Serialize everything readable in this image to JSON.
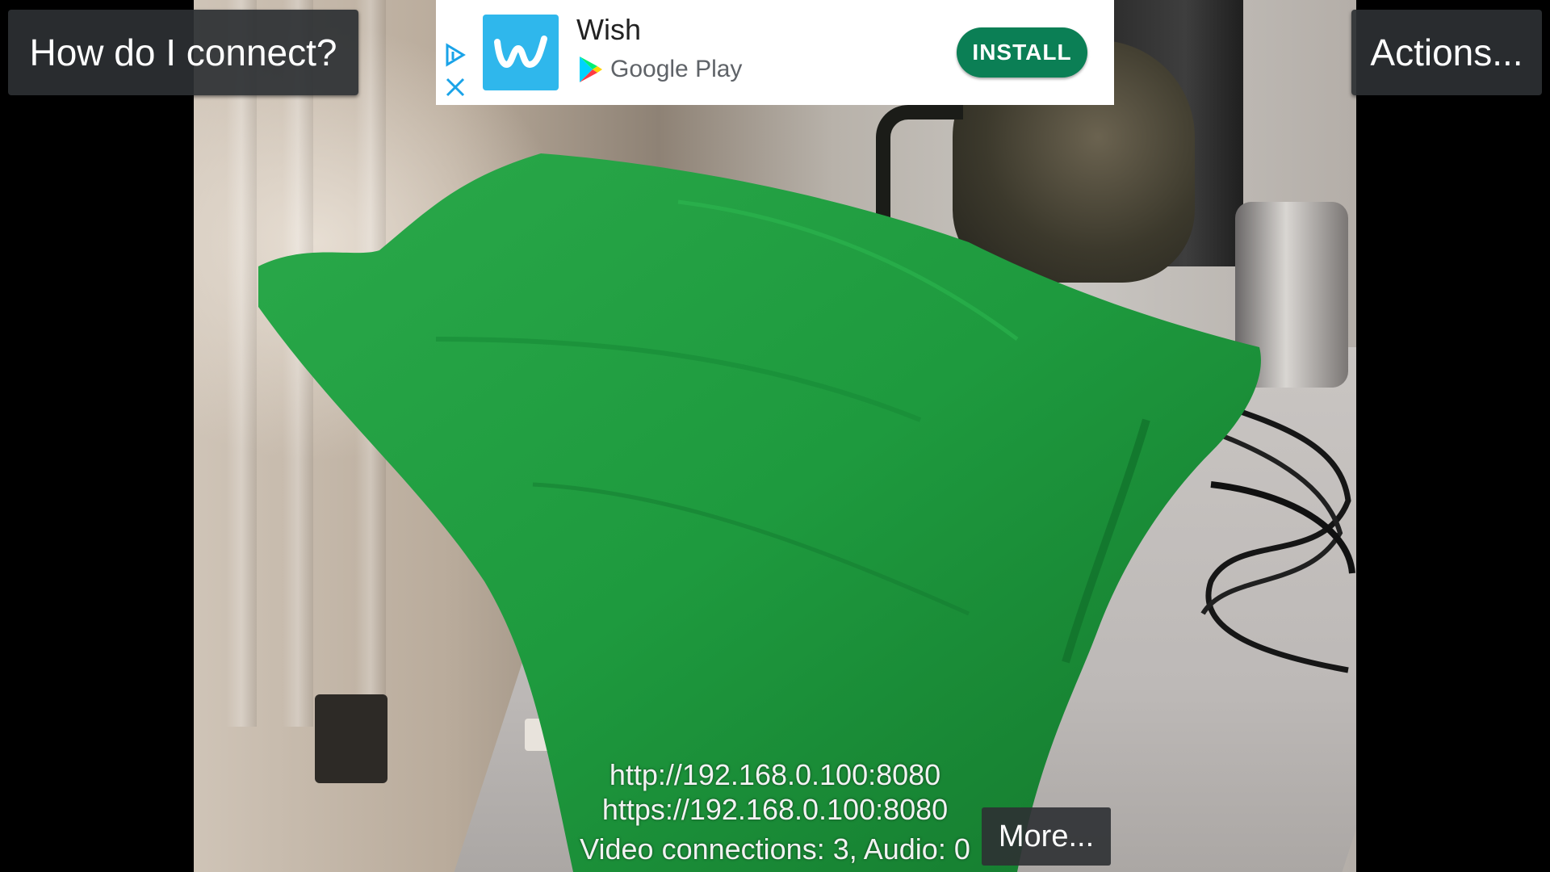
{
  "top_bar": {
    "help_label": "How do I connect?",
    "actions_label": "Actions..."
  },
  "ad": {
    "app_name": "Wish",
    "store_name": "Google Play",
    "install_label": "INSTALL",
    "colors": {
      "icon_bg": "#2fb7ec",
      "install_bg": "#0b7f55"
    }
  },
  "status": {
    "http_url": "http://192.168.0.100:8080",
    "https_url": "https://192.168.0.100:8080",
    "connections": "Video connections: 3, Audio: 0"
  },
  "more_label": "More..."
}
